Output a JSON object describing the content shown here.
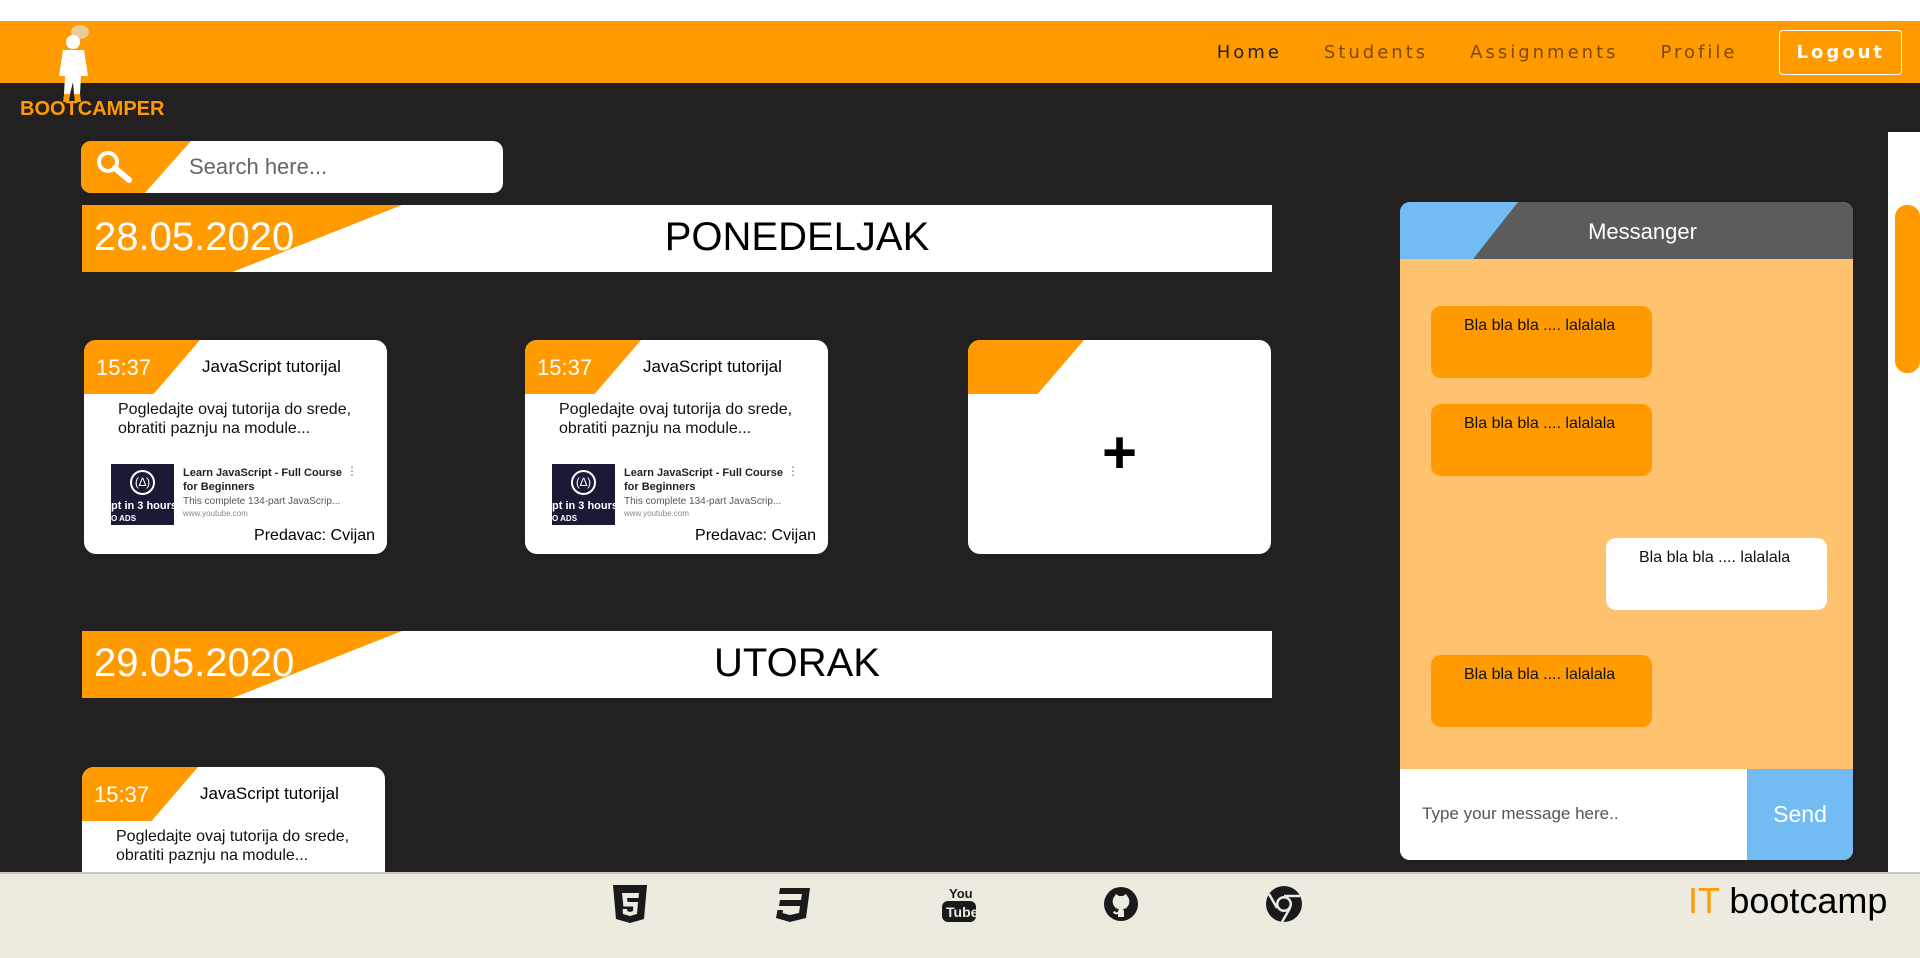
{
  "nav": {
    "brand": "BOOTCAMPER",
    "links": [
      "Home",
      "Students",
      "Assignments",
      "Profile"
    ],
    "logout": "Logout"
  },
  "search": {
    "placeholder": "Search here..."
  },
  "days": [
    {
      "date": "28.05.2020.",
      "day": "PONEDELJAK"
    },
    {
      "date": "29.05.2020.",
      "day": "UTORAK"
    }
  ],
  "cards": [
    {
      "time": "15:37",
      "title": "JavaScript tutorijal",
      "desc": "Pogledajte ovaj tutorija do srede, obratiti paznju na module...",
      "video_title": "Learn JavaScript - Full Course for Beginners",
      "video_desc": "This complete 134-part JavaScrip...",
      "video_site": "www.youtube.com",
      "thumb_text": "pt in 3 hours",
      "thumb_sub": "O ADS",
      "lecturer": "Predavac: Cvijan"
    },
    {
      "time": "15:37",
      "title": "JavaScript tutorijal",
      "desc": "Pogledajte ovaj tutorija do srede, obratiti paznju na module...",
      "video_title": "Learn JavaScript - Full Course for Beginners",
      "video_desc": "This complete 134-part JavaScrip...",
      "video_site": "www.youtube.com",
      "thumb_text": "pt in 3 hours",
      "thumb_sub": "O ADS",
      "lecturer": "Predavac: Cvijan"
    },
    {
      "time": "15:37",
      "title": "JavaScript tutorijal",
      "desc": "Pogledajte ovaj tutorija do srede, obratiti paznju na module..."
    }
  ],
  "add_card": {
    "symbol": "+"
  },
  "messenger": {
    "title": "Messanger",
    "messages": [
      {
        "text": "Bla bla bla .... lalalala",
        "side": "in"
      },
      {
        "text": "Bla bla bla .... lalalala",
        "side": "in"
      },
      {
        "text": "Bla bla bla .... lalalala",
        "side": "out"
      },
      {
        "text": "Bla bla bla .... lalalala",
        "side": "in"
      }
    ],
    "input_placeholder": "Type your message here..",
    "send": "Send"
  },
  "footer": {
    "icons": [
      "html5-icon",
      "css3-icon",
      "youtube-icon",
      "github-icon",
      "chrome-icon"
    ],
    "brand_it": "IT",
    "brand_rest": " bootcamp"
  },
  "colors": {
    "accent": "#FF9A00",
    "dark": "#222021",
    "messenger_bg": "#FFC370",
    "messenger_blue": "#72BBF3",
    "footer_bg": "#EDEBE0"
  }
}
